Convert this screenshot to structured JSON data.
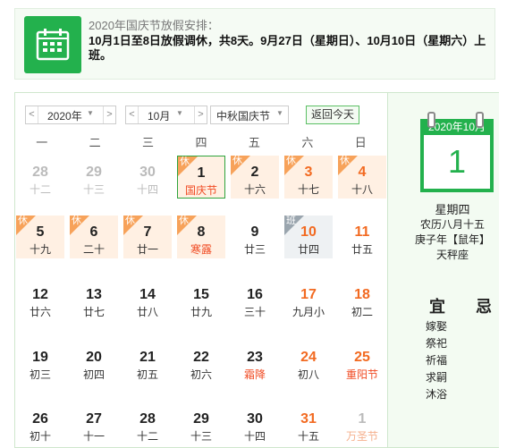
{
  "notice": {
    "title": "2020年国庆节放假安排：",
    "text": "10月1日至8日放假调休，共8天。9月27日（星期日）、10月10日（星期六）上班。"
  },
  "controls": {
    "prev": "<",
    "next": ">",
    "year": "2020年",
    "month": "10月",
    "holiday": "中秋国庆节",
    "today_btn": "返回今天"
  },
  "weekdays": [
    "一",
    "二",
    "三",
    "四",
    "五",
    "六",
    "日"
  ],
  "tags": {
    "rest": "休",
    "work": "班"
  },
  "days": [
    {
      "n": "28",
      "l": "十二",
      "other": true
    },
    {
      "n": "29",
      "l": "十三",
      "other": true
    },
    {
      "n": "30",
      "l": "十四",
      "other": true
    },
    {
      "n": "1",
      "l": "国庆节",
      "tag": "休",
      "lunc": "red",
      "today": true,
      "hol": true
    },
    {
      "n": "2",
      "l": "十六",
      "tag": "休",
      "hol": true
    },
    {
      "n": "3",
      "l": "十七",
      "tag": "休",
      "hol": true,
      "we": true
    },
    {
      "n": "4",
      "l": "十八",
      "tag": "休",
      "hol": true,
      "we": true
    },
    {
      "n": "5",
      "l": "十九",
      "tag": "休",
      "hol": true
    },
    {
      "n": "6",
      "l": "二十",
      "tag": "休",
      "hol": true
    },
    {
      "n": "7",
      "l": "廿一",
      "tag": "休",
      "hol": true
    },
    {
      "n": "8",
      "l": "寒露",
      "tag": "休",
      "hol": true,
      "lunc": "red"
    },
    {
      "n": "9",
      "l": "廿三"
    },
    {
      "n": "10",
      "l": "廿四",
      "tag": "班",
      "work": true,
      "we": true
    },
    {
      "n": "11",
      "l": "廿五",
      "we": true
    },
    {
      "n": "12",
      "l": "廿六"
    },
    {
      "n": "13",
      "l": "廿七"
    },
    {
      "n": "14",
      "l": "廿八"
    },
    {
      "n": "15",
      "l": "廿九"
    },
    {
      "n": "16",
      "l": "三十"
    },
    {
      "n": "17",
      "l": "九月小",
      "we": true
    },
    {
      "n": "18",
      "l": "初二",
      "we": true
    },
    {
      "n": "19",
      "l": "初三"
    },
    {
      "n": "20",
      "l": "初四"
    },
    {
      "n": "21",
      "l": "初五"
    },
    {
      "n": "22",
      "l": "初六"
    },
    {
      "n": "23",
      "l": "霜降",
      "lunc": "red"
    },
    {
      "n": "24",
      "l": "初八",
      "we": true
    },
    {
      "n": "25",
      "l": "重阳节",
      "we": true,
      "lunc": "red"
    },
    {
      "n": "26",
      "l": "初十"
    },
    {
      "n": "27",
      "l": "十一"
    },
    {
      "n": "28",
      "l": "十二"
    },
    {
      "n": "29",
      "l": "十三"
    },
    {
      "n": "30",
      "l": "十四"
    },
    {
      "n": "31",
      "l": "十五",
      "we": true
    },
    {
      "n": "1",
      "l": "万圣节",
      "other": true,
      "lunc": "red"
    }
  ],
  "side": {
    "cal_head": "2020年10月",
    "cal_day": "1",
    "weekday": "星期四",
    "lunar": "农历八月十五",
    "ganzhi": "庚子年【鼠年】",
    "zodiac": "天秤座",
    "yi": "宜",
    "ji": "忌",
    "yi_items": [
      "嫁娶",
      "祭祀",
      "祈福",
      "求嗣",
      "沐浴"
    ]
  },
  "colors": {
    "accent": "#23b14d",
    "weekend": "#f26a21",
    "holiday_bg": "#fff0e3"
  }
}
